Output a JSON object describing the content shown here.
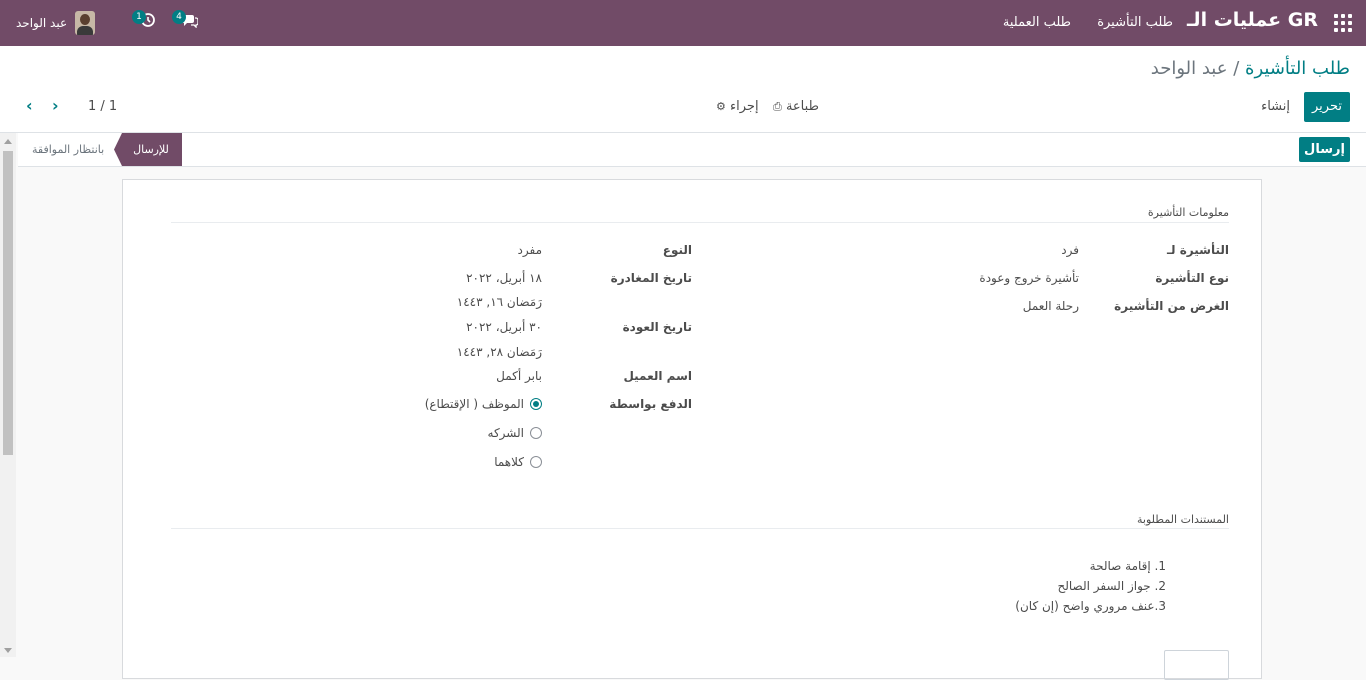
{
  "topbar": {
    "brand": "GR عمليات الـ",
    "menu": [
      "طلب التأشيرة",
      "طلب العملية"
    ],
    "messages_count": "4",
    "activities_count": "1",
    "user_name": "عبد الواحد"
  },
  "control": {
    "breadcrumb_parent": "طلب التأشيرة",
    "breadcrumb_sep": "/",
    "breadcrumb_current": "عبد الواحد",
    "edit_label": "تحرير",
    "create_label": "إنشاء",
    "print_label": "طباعة",
    "action_label": "إجراء",
    "pager": "1 / 1"
  },
  "status": {
    "send_button": "إرسال",
    "stages": [
      "للإرسال",
      "بانتظار الموافقة"
    ],
    "active_stage": "للإرسال"
  },
  "form": {
    "section_visa": "معلومات التأشيرة",
    "right": [
      {
        "label": "التأشيرة لـ",
        "value": "فرد"
      },
      {
        "label": "نوع التأشيرة",
        "value": "تأشيرة خروج وعودة"
      },
      {
        "label": "الغرض من التأشيرة",
        "value": "رحلة العمل"
      }
    ],
    "type_label": "النوع",
    "type_value": "مفرد",
    "departure_label": "تاريخ المغادرة",
    "departure_value": "١٨ أبريل، ٢٠٢٢",
    "departure_hijri": "رَمَضان ١٦, ١٤٤٣",
    "return_label": "تاريخ العودة",
    "return_value": "٣٠ أبريل، ٢٠٢٢",
    "return_hijri": "رَمَضان ٢٨, ١٤٤٣",
    "client_label": "اسم العميل",
    "client_value": "بابر أكمل",
    "payment_label": "الدفع بواسطة",
    "payment_options": [
      "الموظف ( الإقتطاع)",
      "الشركه",
      "كلاهما"
    ],
    "payment_selected": "الموظف ( الإقتطاع)",
    "section_docs": "المستندات المطلوبة",
    "documents": [
      "1. إقامة صالحة",
      "2. جواز السفر الصالح",
      "3.عنف مروري واضح (إن كان)"
    ]
  },
  "colors": {
    "brand": "#714b67",
    "accent": "#017e84"
  }
}
